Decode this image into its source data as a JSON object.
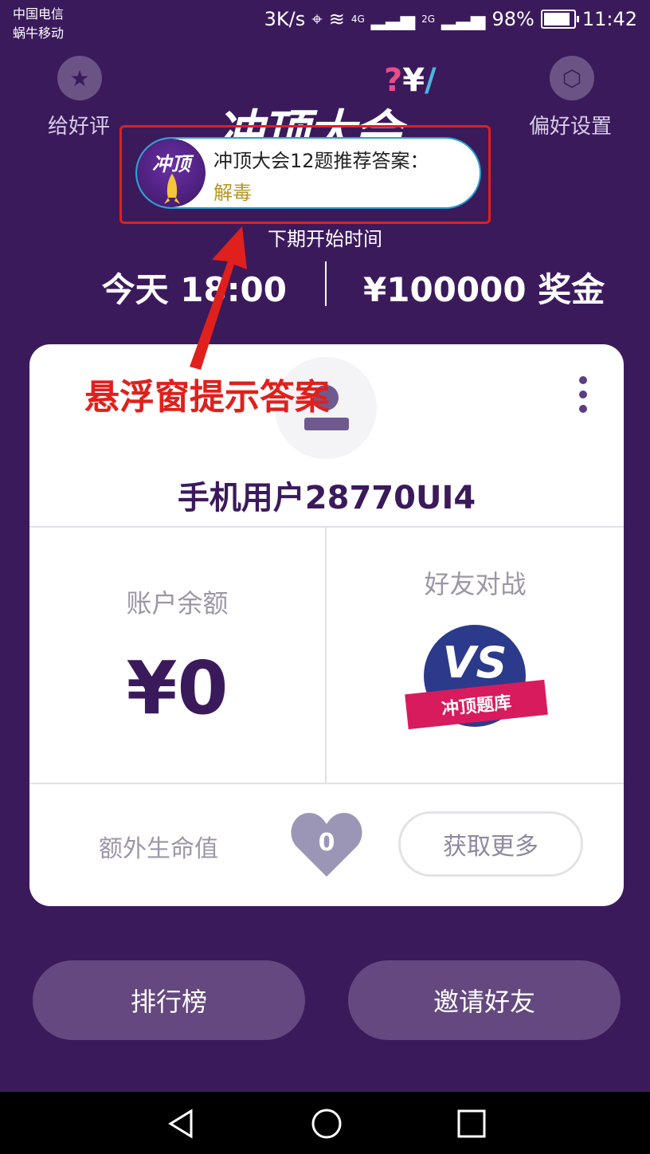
{
  "status_bar": {
    "carrier1": "中国电信",
    "carrier2": "蜗牛移动",
    "speed": "3K/s",
    "network1": "4G",
    "network2": "2G",
    "battery": "98%",
    "time": "11:42"
  },
  "header": {
    "rate_label": "给好评",
    "settings_label": "偏好设置",
    "logo_text": "冲顶大会"
  },
  "floating_window": {
    "avatar_text": "冲顶",
    "title": "冲顶大会12题推荐答案：",
    "answer": "解毒"
  },
  "schedule": {
    "next_label": "下期开始时间",
    "time": "今天 18:00",
    "prize": "¥100000 奖金"
  },
  "annotation": {
    "text": "悬浮窗提示答案",
    "color": "#e0201c"
  },
  "card": {
    "username": "手机用户28770UI4",
    "balance_label": "账户余额",
    "balance_value": "¥0",
    "friend_battle_label": "好友对战",
    "vs_text": "VS",
    "vs_ribbon": "冲顶题库",
    "lives_label": "额外生命值",
    "lives_count": "0",
    "get_more_label": "获取更多"
  },
  "buttons": {
    "leaderboard": "排行榜",
    "invite": "邀请好友"
  },
  "colors": {
    "background": "#3b1a5c",
    "button": "#65487f",
    "accent_red": "#e0201c"
  }
}
